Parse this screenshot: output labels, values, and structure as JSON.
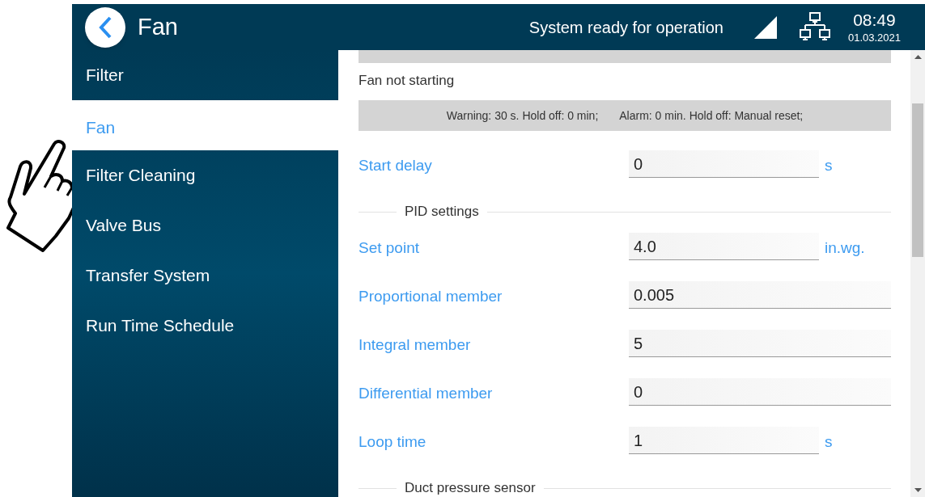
{
  "header": {
    "title": "Fan",
    "status": "System ready for operation",
    "time": "08:49",
    "date": "01.03.2021"
  },
  "sidebar": {
    "items": [
      {
        "label": "Filter",
        "selected": false
      },
      {
        "label": "Fan",
        "selected": true
      },
      {
        "label": "Filter Cleaning",
        "selected": false
      },
      {
        "label": "Valve Bus",
        "selected": false
      },
      {
        "label": "Transfer System",
        "selected": false
      },
      {
        "label": "Run Time Schedule",
        "selected": false
      }
    ]
  },
  "content": [
    {
      "kind": "bar"
    },
    {
      "kind": "caption",
      "text": "Fan not starting"
    },
    {
      "kind": "bar",
      "warning": "Warning: 30 s. Hold off: 0 min;",
      "alarm": "Alarm: 0 min. Hold off: Manual reset;"
    },
    {
      "kind": "field",
      "label": "Start delay",
      "value": "0",
      "unit": "s"
    },
    {
      "kind": "section",
      "text": "PID settings"
    },
    {
      "kind": "field",
      "label": "Set point",
      "value": "4.0",
      "unit": "in.wg."
    },
    {
      "kind": "field",
      "label": "Proportional member",
      "value": "0.005"
    },
    {
      "kind": "field",
      "label": "Integral member",
      "value": "5"
    },
    {
      "kind": "field",
      "label": "Differential member",
      "value": "0"
    },
    {
      "kind": "field",
      "label": "Loop time",
      "value": "1",
      "unit": "s"
    },
    {
      "kind": "section",
      "text": "Duct pressure sensor"
    }
  ]
}
